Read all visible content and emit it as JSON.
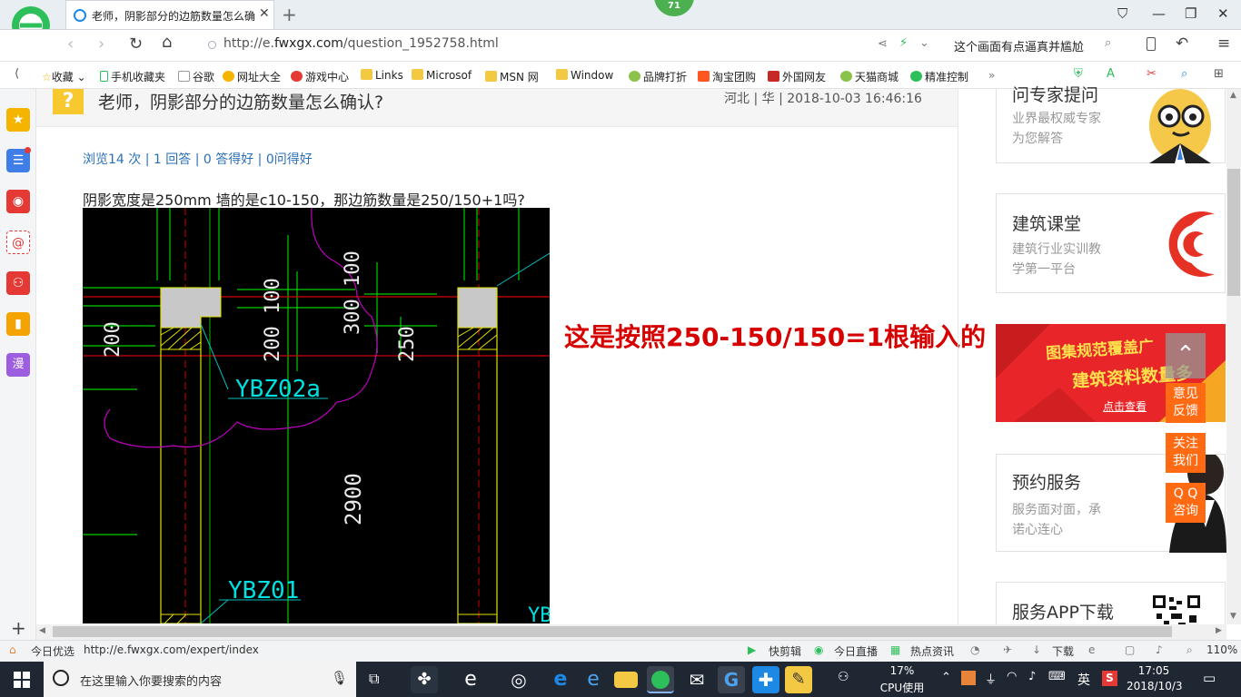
{
  "browser": {
    "tab_title": "老师，阴影部分的边筋数量怎么确认？",
    "badge": "71",
    "url_prefix": "http://e.",
    "url_domain": "fwxgx.com",
    "url_path": "/question_1952758.html",
    "hint_text": "这个画面有点逼真并尴尬"
  },
  "bookmarks": [
    "收藏",
    "手机收藏夹",
    "谷歌",
    "网址大全",
    "游戏中心",
    "Links",
    "Microsof",
    "MSN 网",
    "Window",
    "品牌打折",
    "淘宝团购",
    "外国网友",
    "天猫商城",
    "精准控制"
  ],
  "question": {
    "title": "老师，阴影部分的边筋数量怎么确认?",
    "meta": "河北 | 华 | 2018-10-03 16:46:16",
    "stats": "浏览14 次 | 1 回答 | 0 答得好 | 0问得好",
    "body": "阴影宽度是250mm  墙的是c10-150，那边筋数量是250/150+1吗?",
    "annotation": "这是按照250-150/150=1根输入的"
  },
  "cad": {
    "labels": [
      "200",
      "200 100",
      "300 100",
      "250",
      "YBZ02a",
      "2900",
      "YBZ01",
      "YB"
    ]
  },
  "right": {
    "cards": [
      {
        "title": "问专家提问",
        "sub": [
          "业界最权威专家",
          "为您解答"
        ]
      },
      {
        "title": "建筑课堂",
        "sub": [
          "建筑行业实训教",
          "学第一平台"
        ]
      },
      {
        "title": "预约服务",
        "sub": [
          "服务面对面，承",
          "诺心连心"
        ]
      },
      {
        "title": "服务APP下载",
        "sub": []
      }
    ],
    "banner": {
      "line1": "图集规范覆盖广",
      "line2": "建筑资料数量多",
      "link": "点击查看"
    },
    "float": [
      "意见\n反馈",
      "关注\n我们",
      "Q Q\n咨询"
    ]
  },
  "status": {
    "left_label": "今日优选",
    "url": "http://e.fwxgx.com/expert/index",
    "items": [
      "快剪辑",
      "今日直播",
      "热点资讯",
      "下载"
    ],
    "zoom": "110%"
  },
  "taskbar": {
    "search_placeholder": "在这里输入你要搜索的内容",
    "cpu_pct": "17%",
    "cpu_label": "CPU使用",
    "ime": "英",
    "time": "17:05",
    "date": "2018/10/3"
  },
  "colors": {
    "accent": "#4caf50",
    "float_orange": "#ff6a13",
    "annotation_red": "#d60000",
    "link_blue": "#2a6fb5"
  }
}
